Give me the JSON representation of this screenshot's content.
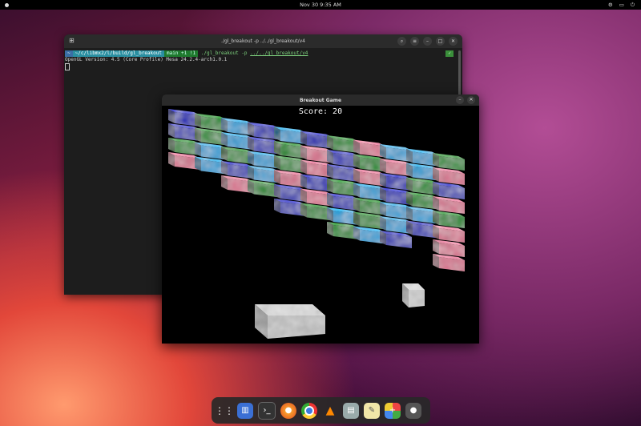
{
  "topbar": {
    "datetime": "Nov 30   9:35 AM"
  },
  "terminal": {
    "title": "./gl_breakout -p ../../gl_breakout/v4",
    "prompt": {
      "user_seg": "~",
      "path_seg": "~/c/libmx2/l/build/gl_breakout",
      "git_seg": "main +1 !1",
      "tick": "✓"
    },
    "command": "./gl_breakout -p ",
    "command_path": "../../gl_breakout/v4",
    "output": "OpenGL Version: 4.5 (Core Profile) Mesa 24.2.4-arch1.0.1"
  },
  "game": {
    "title": "Breakout Game",
    "score_label": "Score: 20",
    "colors": {
      "blue": "#2a2fb5",
      "green": "#1f8a2a",
      "cyan": "#2a9fd6",
      "pink": "#d9738e",
      "white": "#d8d8d8"
    }
  },
  "dock": {
    "items": [
      "apps-grid-icon",
      "text-editor-icon",
      "terminal-icon",
      "firefox-icon",
      "chrome-icon",
      "vlc-icon",
      "files-icon",
      "notes-icon",
      "software-icon",
      "gl-breakout-icon"
    ]
  }
}
